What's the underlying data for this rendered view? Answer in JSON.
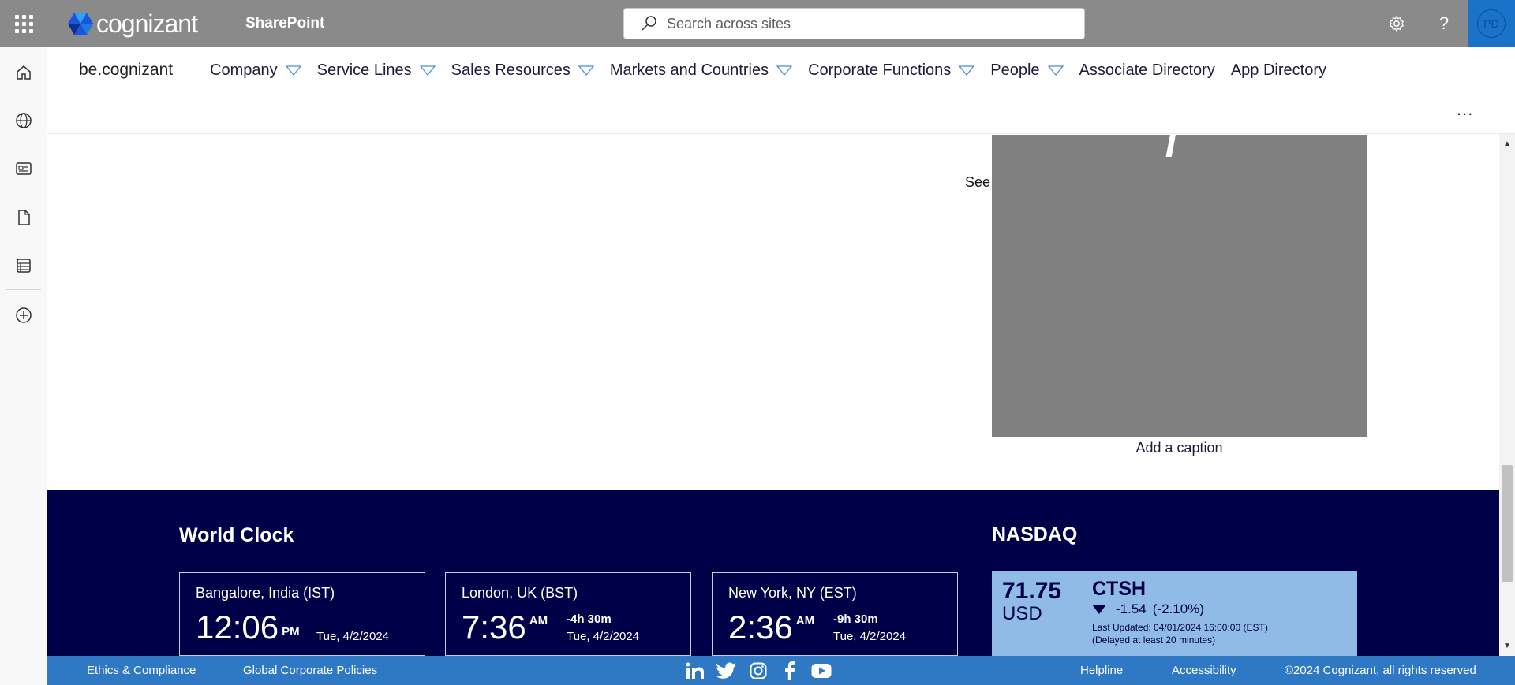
{
  "suite": {
    "brand": "cognizant",
    "app": "SharePoint",
    "search_placeholder": "Search across sites",
    "avatar_initials": "PD"
  },
  "hub": {
    "site_title": "be.cognizant",
    "nav": [
      {
        "label": "Company",
        "dropdown": true
      },
      {
        "label": "Service Lines",
        "dropdown": true
      },
      {
        "label": "Sales Resources",
        "dropdown": true
      },
      {
        "label": "Markets and Countries",
        "dropdown": true
      },
      {
        "label": "Corporate Functions",
        "dropdown": true
      },
      {
        "label": "People",
        "dropdown": true
      },
      {
        "label": "Associate Directory",
        "dropdown": false
      },
      {
        "label": "App Directory",
        "dropdown": false
      }
    ],
    "more": "..."
  },
  "content": {
    "see_all": "See all",
    "image_caption": "Add a caption"
  },
  "world_clock": {
    "title": "World Clock",
    "clocks": [
      {
        "city": "Bangalore, India (IST)",
        "time": "12:06",
        "ampm": "PM",
        "offset": "",
        "date": "Tue, 4/2/2024"
      },
      {
        "city": "London, UK (BST)",
        "time": "7:36",
        "ampm": "AM",
        "offset": "-4h 30m",
        "date": "Tue, 4/2/2024"
      },
      {
        "city": "New York, NY (EST)",
        "time": "2:36",
        "ampm": "AM",
        "offset": "-9h 30m",
        "date": "Tue, 4/2/2024"
      }
    ]
  },
  "nasdaq": {
    "title": "NASDAQ",
    "price": "71.75",
    "currency": "USD",
    "symbol": "CTSH",
    "change": "-1.54",
    "change_pct": "(-2.10%)",
    "last_updated": "Last Updated: 04/01/2024 16:00:00 (EST)",
    "delay_note": "(Delayed at least 20 minutes)"
  },
  "footer": {
    "ethics": "Ethics & Compliance",
    "policies": "Global Corporate Policies",
    "helpline": "Helpline",
    "accessibility": "Accessibility",
    "copyright": "©2024 Cognizant, all rights reserved",
    "social": [
      "linkedin-icon",
      "twitter-icon",
      "instagram-icon",
      "facebook-icon",
      "youtube-icon"
    ]
  },
  "colors": {
    "suitebar": "#8a8a8a",
    "band": "#000048",
    "footer": "#2f78c4",
    "stock_card": "#8fbbe6"
  }
}
